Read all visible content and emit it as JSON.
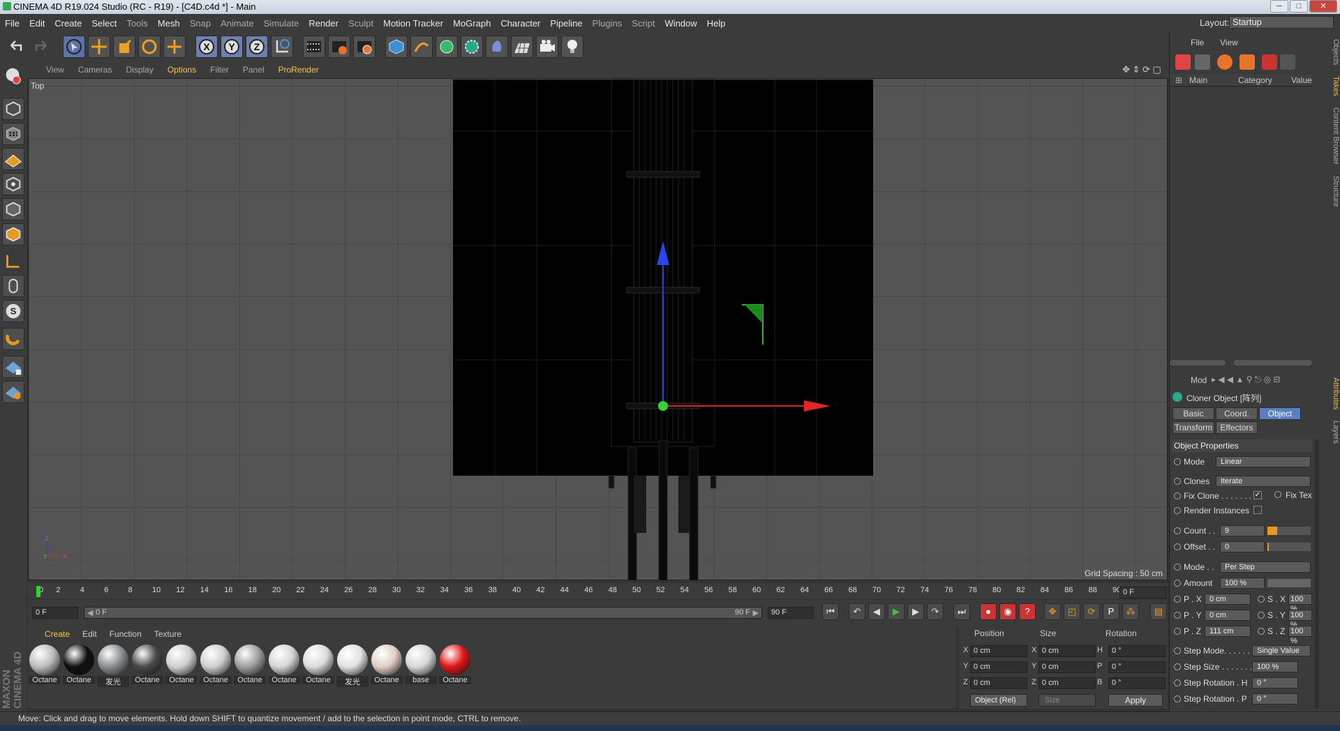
{
  "window": {
    "title": "CINEMA 4D R19.024 Studio (RC - R19) - [C4D.c4d *] - Main"
  },
  "menu": [
    "File",
    "Edit",
    "Create",
    "Select",
    "Tools",
    "Mesh",
    "Snap",
    "Animate",
    "Simulate",
    "Render",
    "Sculpt",
    "Motion Tracker",
    "MoGraph",
    "Character",
    "Pipeline",
    "Plugins",
    "Script",
    "Window",
    "Help"
  ],
  "layout": {
    "label": "Layout:",
    "value": "Startup"
  },
  "viewport": {
    "menu": [
      "View",
      "Cameras",
      "Display",
      "Options",
      "Filter",
      "Panel",
      "ProRender"
    ],
    "label": "Top",
    "grid_spacing": "Grid Spacing : 50 cm"
  },
  "timeline": {
    "ticks": [
      "0",
      "2",
      "4",
      "6",
      "8",
      "10",
      "12",
      "14",
      "16",
      "18",
      "20",
      "22",
      "24",
      "26",
      "28",
      "30",
      "32",
      "34",
      "36",
      "38",
      "40",
      "42",
      "44",
      "46",
      "48",
      "50",
      "52",
      "54",
      "56",
      "58",
      "60",
      "62",
      "64",
      "66",
      "68",
      "70",
      "72",
      "74",
      "76",
      "78",
      "80",
      "82",
      "84",
      "86",
      "88",
      "90"
    ],
    "current_frame": "0 F",
    "start": "0 F",
    "range_start": "0 F",
    "range_end": "90 F",
    "end": "90 F"
  },
  "materials": {
    "menu": [
      "Create",
      "Edit",
      "Function",
      "Texture"
    ],
    "items": [
      {
        "label": "Octane",
        "color": "#bdbdbd"
      },
      {
        "label": "Octane",
        "color": "#101010"
      },
      {
        "label": "发光",
        "color": "#8a8f94"
      },
      {
        "label": "Octane",
        "color": "#4a4a4a"
      },
      {
        "label": "Octane",
        "color": "#d0d0d0"
      },
      {
        "label": "Octane",
        "color": "#cfcfcf"
      },
      {
        "label": "Octane",
        "color": "#a0a0a0"
      },
      {
        "label": "Octane",
        "color": "#d6d6d6"
      },
      {
        "label": "Octane",
        "color": "#dcdcdc"
      },
      {
        "label": "发光",
        "color": "#e2e2e2"
      },
      {
        "label": "Octane",
        "color": "#e0cfc4"
      },
      {
        "label": "base",
        "color": "#d8d8d8"
      },
      {
        "label": "Octane",
        "color": "#e01515"
      }
    ]
  },
  "coords": {
    "headers": [
      "Position",
      "Size",
      "Rotation"
    ],
    "rows": [
      {
        "a": "X",
        "pos": "0 cm",
        "b": "X",
        "size": "0 cm",
        "c": "H",
        "rot": "0 °"
      },
      {
        "a": "Y",
        "pos": "0 cm",
        "b": "Y",
        "size": "0 cm",
        "c": "P",
        "rot": "0 °"
      },
      {
        "a": "Z",
        "pos": "0 cm",
        "b": "Z",
        "size": "0 cm",
        "c": "B",
        "rot": "0 °"
      }
    ],
    "mode": "Object (Rel)",
    "size_mode": "Size",
    "apply": "Apply"
  },
  "objects_panel": {
    "menu": [
      "File",
      "View"
    ],
    "columns": [
      "Main",
      "Category",
      "Value"
    ]
  },
  "attributes": {
    "mode_label": "Mod",
    "object_title": "Cloner Object [阵列]",
    "tabs": [
      "Basic",
      "Coord.",
      "Object",
      "Transform",
      "Effectors"
    ],
    "active_tab": "Object",
    "section": "Object Properties",
    "props": {
      "mode_label": "Mode",
      "mode_value": "Linear",
      "clones_label": "Clones",
      "clones_value": "Iterate",
      "fix_clone": "Fix Clone . . . . . . .",
      "fix_tex": "Fix Tex",
      "render_instances": "Render Instances",
      "count_label": "Count . .",
      "count_value": "9",
      "offset_label": "Offset . .",
      "offset_value": "0",
      "mode2_label": "Mode . .",
      "mode2_value": "Per Step",
      "amount_label": "Amount",
      "amount_value": "100 %",
      "px_label": "P . X",
      "px_value": "0 cm",
      "py_label": "P . Y",
      "py_value": "0 cm",
      "pz_label": "P . Z",
      "pz_value": "111 cm",
      "sx_label": "S . X",
      "sx_value": "100 %",
      "sy_label": "S . Y",
      "sy_value": "100 %",
      "sz_label": "S . Z",
      "sz_value": "100 %",
      "step_mode_label": "Step Mode. . . . . . .",
      "step_mode_value": "Single Value",
      "step_size_label": "Step Size . . . . . . .",
      "step_size_value": "100 %",
      "step_rot_h_label": "Step Rotation . H",
      "step_rot_h_value": "0 °",
      "step_rot_p_label": "Step Rotation . P",
      "step_rot_p_value": "0 °"
    }
  },
  "side_tabs": [
    "Objects",
    "Takes",
    "Content Browser",
    "Structure",
    "Attributes",
    "Layers"
  ],
  "status": "Move: Click and drag to move elements. Hold down SHIFT to quantize movement / add to the selection in point mode, CTRL to remove."
}
